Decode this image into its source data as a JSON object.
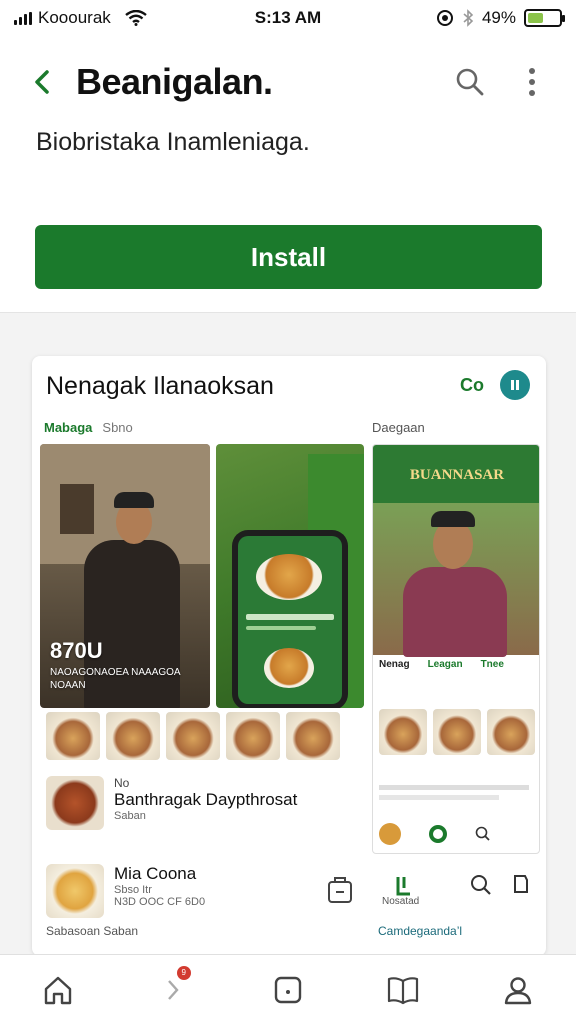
{
  "status_bar": {
    "carrier": "Kooourak",
    "time": "S:13 AM",
    "battery": "49%",
    "battery_level": 0.49
  },
  "header": {
    "title": "Beanigalan.",
    "subtitle": "Biobristaka Inamleniaga."
  },
  "install_label": "Install",
  "card": {
    "title": "Nenagak Ilanaoksan",
    "title_icon_text": "Co",
    "tabs": [
      "Mabaga",
      "Sbno"
    ],
    "right_label": "Daegaan",
    "photo1_overlay_title": "870U",
    "photo1_overlay_sub": "NAOAGONAOEA NAAAGOA NOAAN",
    "photo3_banner": "BUANNASAR",
    "photo3_tabs": [
      "Nenag",
      "Leagan",
      "Tnee"
    ],
    "list": [
      {
        "small": "No",
        "title": "Banthragak Daypthrosat",
        "meta": "Saban"
      },
      {
        "small": "",
        "title": "Mia Coona",
        "meta": "Sbso Itr",
        "meta2": "N3D OOC CF 6D0"
      }
    ],
    "footnote_left": "Sabasoan Saban",
    "footnote_right": "Camdegaanda’l",
    "bottom_right_label": "Nosatad"
  },
  "nav_badge": "9",
  "colors": {
    "brand_green": "#1b7a2c",
    "accent_teal": "#1e8a8c"
  }
}
